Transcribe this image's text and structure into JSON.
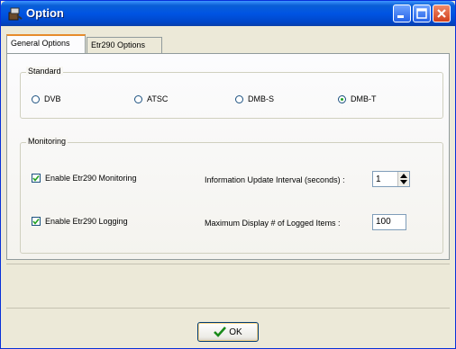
{
  "window": {
    "title": "Option",
    "icon": "tool-app-icon"
  },
  "title_buttons": {
    "minimize_icon": "minimize-icon",
    "maximize_icon": "maximize-icon",
    "close_icon": "close-icon"
  },
  "tabs": [
    {
      "label": "General Options",
      "active": true
    },
    {
      "label": "Etr290 Options",
      "active": false
    }
  ],
  "standard": {
    "legend": "Standard",
    "options": [
      {
        "label": "DVB",
        "checked": false
      },
      {
        "label": "ATSC",
        "checked": false
      },
      {
        "label": "DMB-S",
        "checked": false
      },
      {
        "label": "DMB-T",
        "checked": true
      }
    ]
  },
  "monitoring": {
    "legend": "Monitoring",
    "enable_monitoring": {
      "label": "Enable Etr290 Monitoring",
      "checked": true
    },
    "enable_logging": {
      "label": "Enable Etr290 Logging",
      "checked": true
    },
    "update_interval": {
      "label": "Information Update Interval (seconds) :",
      "value": "1"
    },
    "max_display": {
      "label": "Maximum Display # of Logged Items :",
      "value": "100"
    }
  },
  "ok_button": {
    "label": "OK",
    "icon": "checkmark-icon"
  },
  "colors": {
    "title_blue": "#0054e3",
    "face": "#ece9d8",
    "check_green": "#21a121",
    "tab_accent": "#e68b2c"
  }
}
